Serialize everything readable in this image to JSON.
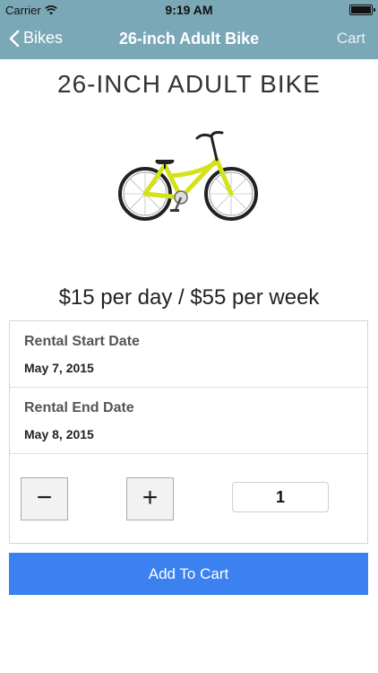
{
  "status_bar": {
    "carrier": "Carrier",
    "time": "9:19 AM"
  },
  "nav": {
    "back_label": "Bikes",
    "title": "26-inch Adult Bike",
    "cart_label": "Cart"
  },
  "product": {
    "title": "26-INCH ADULT BIKE",
    "price": "$15 per day / $55 per week",
    "image_icon": "bike-image"
  },
  "rental": {
    "start_label": "Rental Start Date",
    "start_value": "May 7, 2015",
    "end_label": "Rental End Date",
    "end_value": "May 8, 2015"
  },
  "quantity": {
    "minus": "−",
    "plus": "+",
    "value": "1"
  },
  "actions": {
    "add_to_cart": "Add To Cart"
  },
  "colors": {
    "nav_bg": "#7aa8b7",
    "button_blue": "#3b82f0",
    "bike_frame": "#d4e21a"
  }
}
